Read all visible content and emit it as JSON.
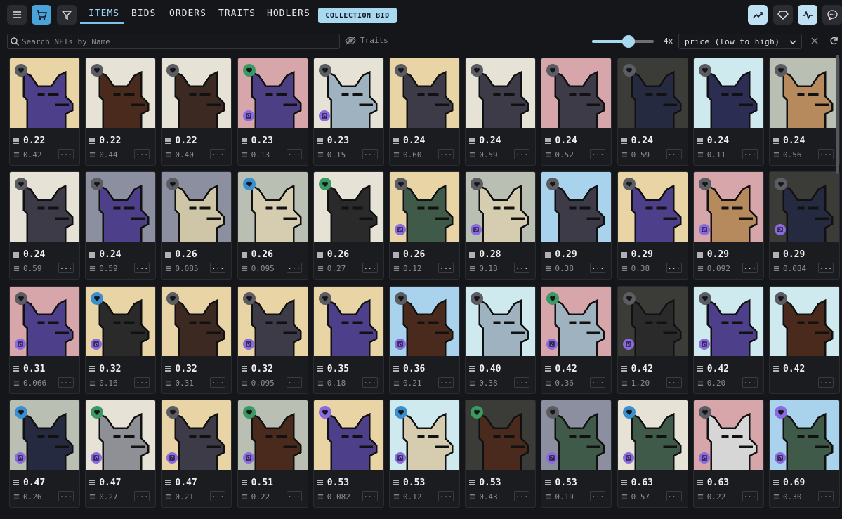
{
  "nav": {
    "tabs": [
      "ITEMS",
      "BIDS",
      "ORDERS",
      "TRAITS",
      "HODLERS"
    ],
    "active_tab": "ITEMS",
    "collection_bid_label": "COLLECTION BID",
    "left_icons": [
      "menu-icon",
      "cart-icon",
      "filter-icon"
    ],
    "right_icons": [
      "trending-chart-icon",
      "diamond-icon",
      "activity-icon",
      "chat-icon"
    ]
  },
  "filters": {
    "search_placeholder": "Search NFTs by Name",
    "traits_label": "Traits",
    "zoom_label": "4x",
    "zoom_level": 0.55,
    "sort_label": "price (low to high)"
  },
  "colors": {
    "accent": "#a9d8f1",
    "badge_purple": "#8a6ae0",
    "heart_gray": "#5c5d62",
    "heart_blue": "#3a8fd0",
    "heart_green": "#3a9a62"
  },
  "items": [
    {
      "price": "0.22",
      "last": "0.42",
      "bg": "#e9d4a6",
      "fur": "#4e3f8a",
      "heart": "gray",
      "badge": false
    },
    {
      "price": "0.22",
      "last": "0.44",
      "bg": "#e6e2d6",
      "fur": "#4a2a1c",
      "heart": "gray",
      "badge": false
    },
    {
      "price": "0.22",
      "last": "0.40",
      "bg": "#e6e2d6",
      "fur": "#3c2a22",
      "heart": "gray",
      "badge": false
    },
    {
      "price": "0.23",
      "last": "0.13",
      "bg": "#d7a6ab",
      "fur": "#4d3f84",
      "heart": "green",
      "badge": true
    },
    {
      "price": "0.23",
      "last": "0.15",
      "bg": "#e6e2d6",
      "fur": "#9fb2bf",
      "heart": "gray",
      "badge": true
    },
    {
      "price": "0.24",
      "last": "0.60",
      "bg": "#e9d4a6",
      "fur": "#3e3b48",
      "heart": "gray",
      "badge": false
    },
    {
      "price": "0.24",
      "last": "0.59",
      "bg": "#e6e2d6",
      "fur": "#3e3b48",
      "heart": "gray",
      "badge": false
    },
    {
      "price": "0.24",
      "last": "0.52",
      "bg": "#d7a6ab",
      "fur": "#3e3b48",
      "heart": "gray",
      "badge": false
    },
    {
      "price": "0.24",
      "last": "0.59",
      "bg": "#3b3c38",
      "fur": "#262a40",
      "heart": "gray",
      "badge": false
    },
    {
      "price": "0.24",
      "last": "0.11",
      "bg": "#cfeaee",
      "fur": "#2c2d52",
      "heart": "gray",
      "badge": false
    },
    {
      "price": "0.24",
      "last": "0.56",
      "bg": "#b9bfb2",
      "fur": "#b78a5e",
      "heart": "gray",
      "badge": false
    },
    {
      "price": "0.24",
      "last": "0.59",
      "bg": "#e6e2d6",
      "fur": "#3e3b48",
      "heart": "gray",
      "badge": false
    },
    {
      "price": "0.24",
      "last": "0.59",
      "bg": "#8c8fa0",
      "fur": "#4e3f8a",
      "heart": "gray",
      "badge": false
    },
    {
      "price": "0.26",
      "last": "0.085",
      "bg": "#8c8fa0",
      "fur": "#cfc6a8",
      "heart": "gray",
      "badge": false
    },
    {
      "price": "0.26",
      "last": "0.095",
      "bg": "#b9bfb2",
      "fur": "#d6cdb0",
      "heart": "blue",
      "badge": false
    },
    {
      "price": "0.26",
      "last": "0.27",
      "bg": "#e6e2d6",
      "fur": "#2a2a2a",
      "heart": "green",
      "badge": false
    },
    {
      "price": "0.26",
      "last": "0.12",
      "bg": "#e9d4a6",
      "fur": "#3f5a48",
      "heart": "gray",
      "badge": true
    },
    {
      "price": "0.28",
      "last": "0.18",
      "bg": "#b9bfb2",
      "fur": "#d6cdb0",
      "heart": "gray",
      "badge": true
    },
    {
      "price": "0.29",
      "last": "0.38",
      "bg": "#a9d2ec",
      "fur": "#3e3b48",
      "heart": "gray",
      "badge": false
    },
    {
      "price": "0.29",
      "last": "0.38",
      "bg": "#e9d4a6",
      "fur": "#4e3f8a",
      "heart": "gray",
      "badge": false
    },
    {
      "price": "0.29",
      "last": "0.092",
      "bg": "#d7a6ab",
      "fur": "#b78a5e",
      "heart": "gray",
      "badge": true
    },
    {
      "price": "0.29",
      "last": "0.084",
      "bg": "#3b3c38",
      "fur": "#262a40",
      "heart": "gray",
      "badge": true
    },
    {
      "price": "0.31",
      "last": "0.066",
      "bg": "#d7a6ab",
      "fur": "#4e3f8a",
      "heart": "gray",
      "badge": true
    },
    {
      "price": "0.32",
      "last": "0.16",
      "bg": "#e9d4a6",
      "fur": "#2a2a2a",
      "heart": "blue",
      "badge": true
    },
    {
      "price": "0.32",
      "last": "0.31",
      "bg": "#e9d4a6",
      "fur": "#3c2a22",
      "heart": "gray",
      "badge": false
    },
    {
      "price": "0.32",
      "last": "0.095",
      "bg": "#e9d4a6",
      "fur": "#3e3b48",
      "heart": "gray",
      "badge": true
    },
    {
      "price": "0.35",
      "last": "0.18",
      "bg": "#e9d4a6",
      "fur": "#4e3f8a",
      "heart": "gray",
      "badge": false
    },
    {
      "price": "0.36",
      "last": "0.21",
      "bg": "#a9d2ec",
      "fur": "#4a2a1c",
      "heart": "gray",
      "badge": true
    },
    {
      "price": "0.40",
      "last": "0.38",
      "bg": "#cfeaee",
      "fur": "#9fb2bf",
      "heart": "gray",
      "badge": false
    },
    {
      "price": "0.42",
      "last": "0.36",
      "bg": "#d7a6ab",
      "fur": "#9fb2bf",
      "heart": "green",
      "badge": true
    },
    {
      "price": "0.42",
      "last": "1.20",
      "bg": "#3b3c38",
      "fur": "#2a2a2a",
      "heart": "gray",
      "badge": true
    },
    {
      "price": "0.42",
      "last": "0.20",
      "bg": "#cfeaee",
      "fur": "#4e3f8a",
      "heart": "gray",
      "badge": true
    },
    {
      "price": "0.42",
      "last": "",
      "bg": "#cfeaee",
      "fur": "#4a2a1c",
      "heart": "gray",
      "badge": false
    },
    {
      "price": "0.47",
      "last": "0.26",
      "bg": "#b9bfb2",
      "fur": "#262a40",
      "heart": "blue",
      "badge": true
    },
    {
      "price": "0.47",
      "last": "0.27",
      "bg": "#e6e2d6",
      "fur": "#8f9096",
      "heart": "green",
      "badge": true
    },
    {
      "price": "0.47",
      "last": "0.21",
      "bg": "#e9d4a6",
      "fur": "#3e3b48",
      "heart": "gray",
      "badge": true
    },
    {
      "price": "0.51",
      "last": "0.22",
      "bg": "#b9bfb2",
      "fur": "#4a2a1c",
      "heart": "green",
      "badge": true
    },
    {
      "price": "0.53",
      "last": "0.082",
      "bg": "#e9d4a6",
      "fur": "#4e3f8a",
      "heart": "purple",
      "badge": false
    },
    {
      "price": "0.53",
      "last": "0.12",
      "bg": "#cfeaee",
      "fur": "#d6cdb0",
      "heart": "blue",
      "badge": true
    },
    {
      "price": "0.53",
      "last": "0.43",
      "bg": "#3b3c38",
      "fur": "#4a2a1c",
      "heart": "green",
      "badge": false
    },
    {
      "price": "0.53",
      "last": "0.19",
      "bg": "#8c8fa0",
      "fur": "#3f5a48",
      "heart": "gray",
      "badge": true
    },
    {
      "price": "0.63",
      "last": "0.57",
      "bg": "#e6e2d6",
      "fur": "#3f5a48",
      "heart": "blue",
      "badge": true
    },
    {
      "price": "0.63",
      "last": "0.22",
      "bg": "#d7a6ab",
      "fur": "#d6d6d6",
      "heart": "gray",
      "badge": true
    },
    {
      "price": "0.69",
      "last": "0.30",
      "bg": "#a9d2ec",
      "fur": "#3f5a48",
      "heart": "purple",
      "badge": true
    }
  ]
}
